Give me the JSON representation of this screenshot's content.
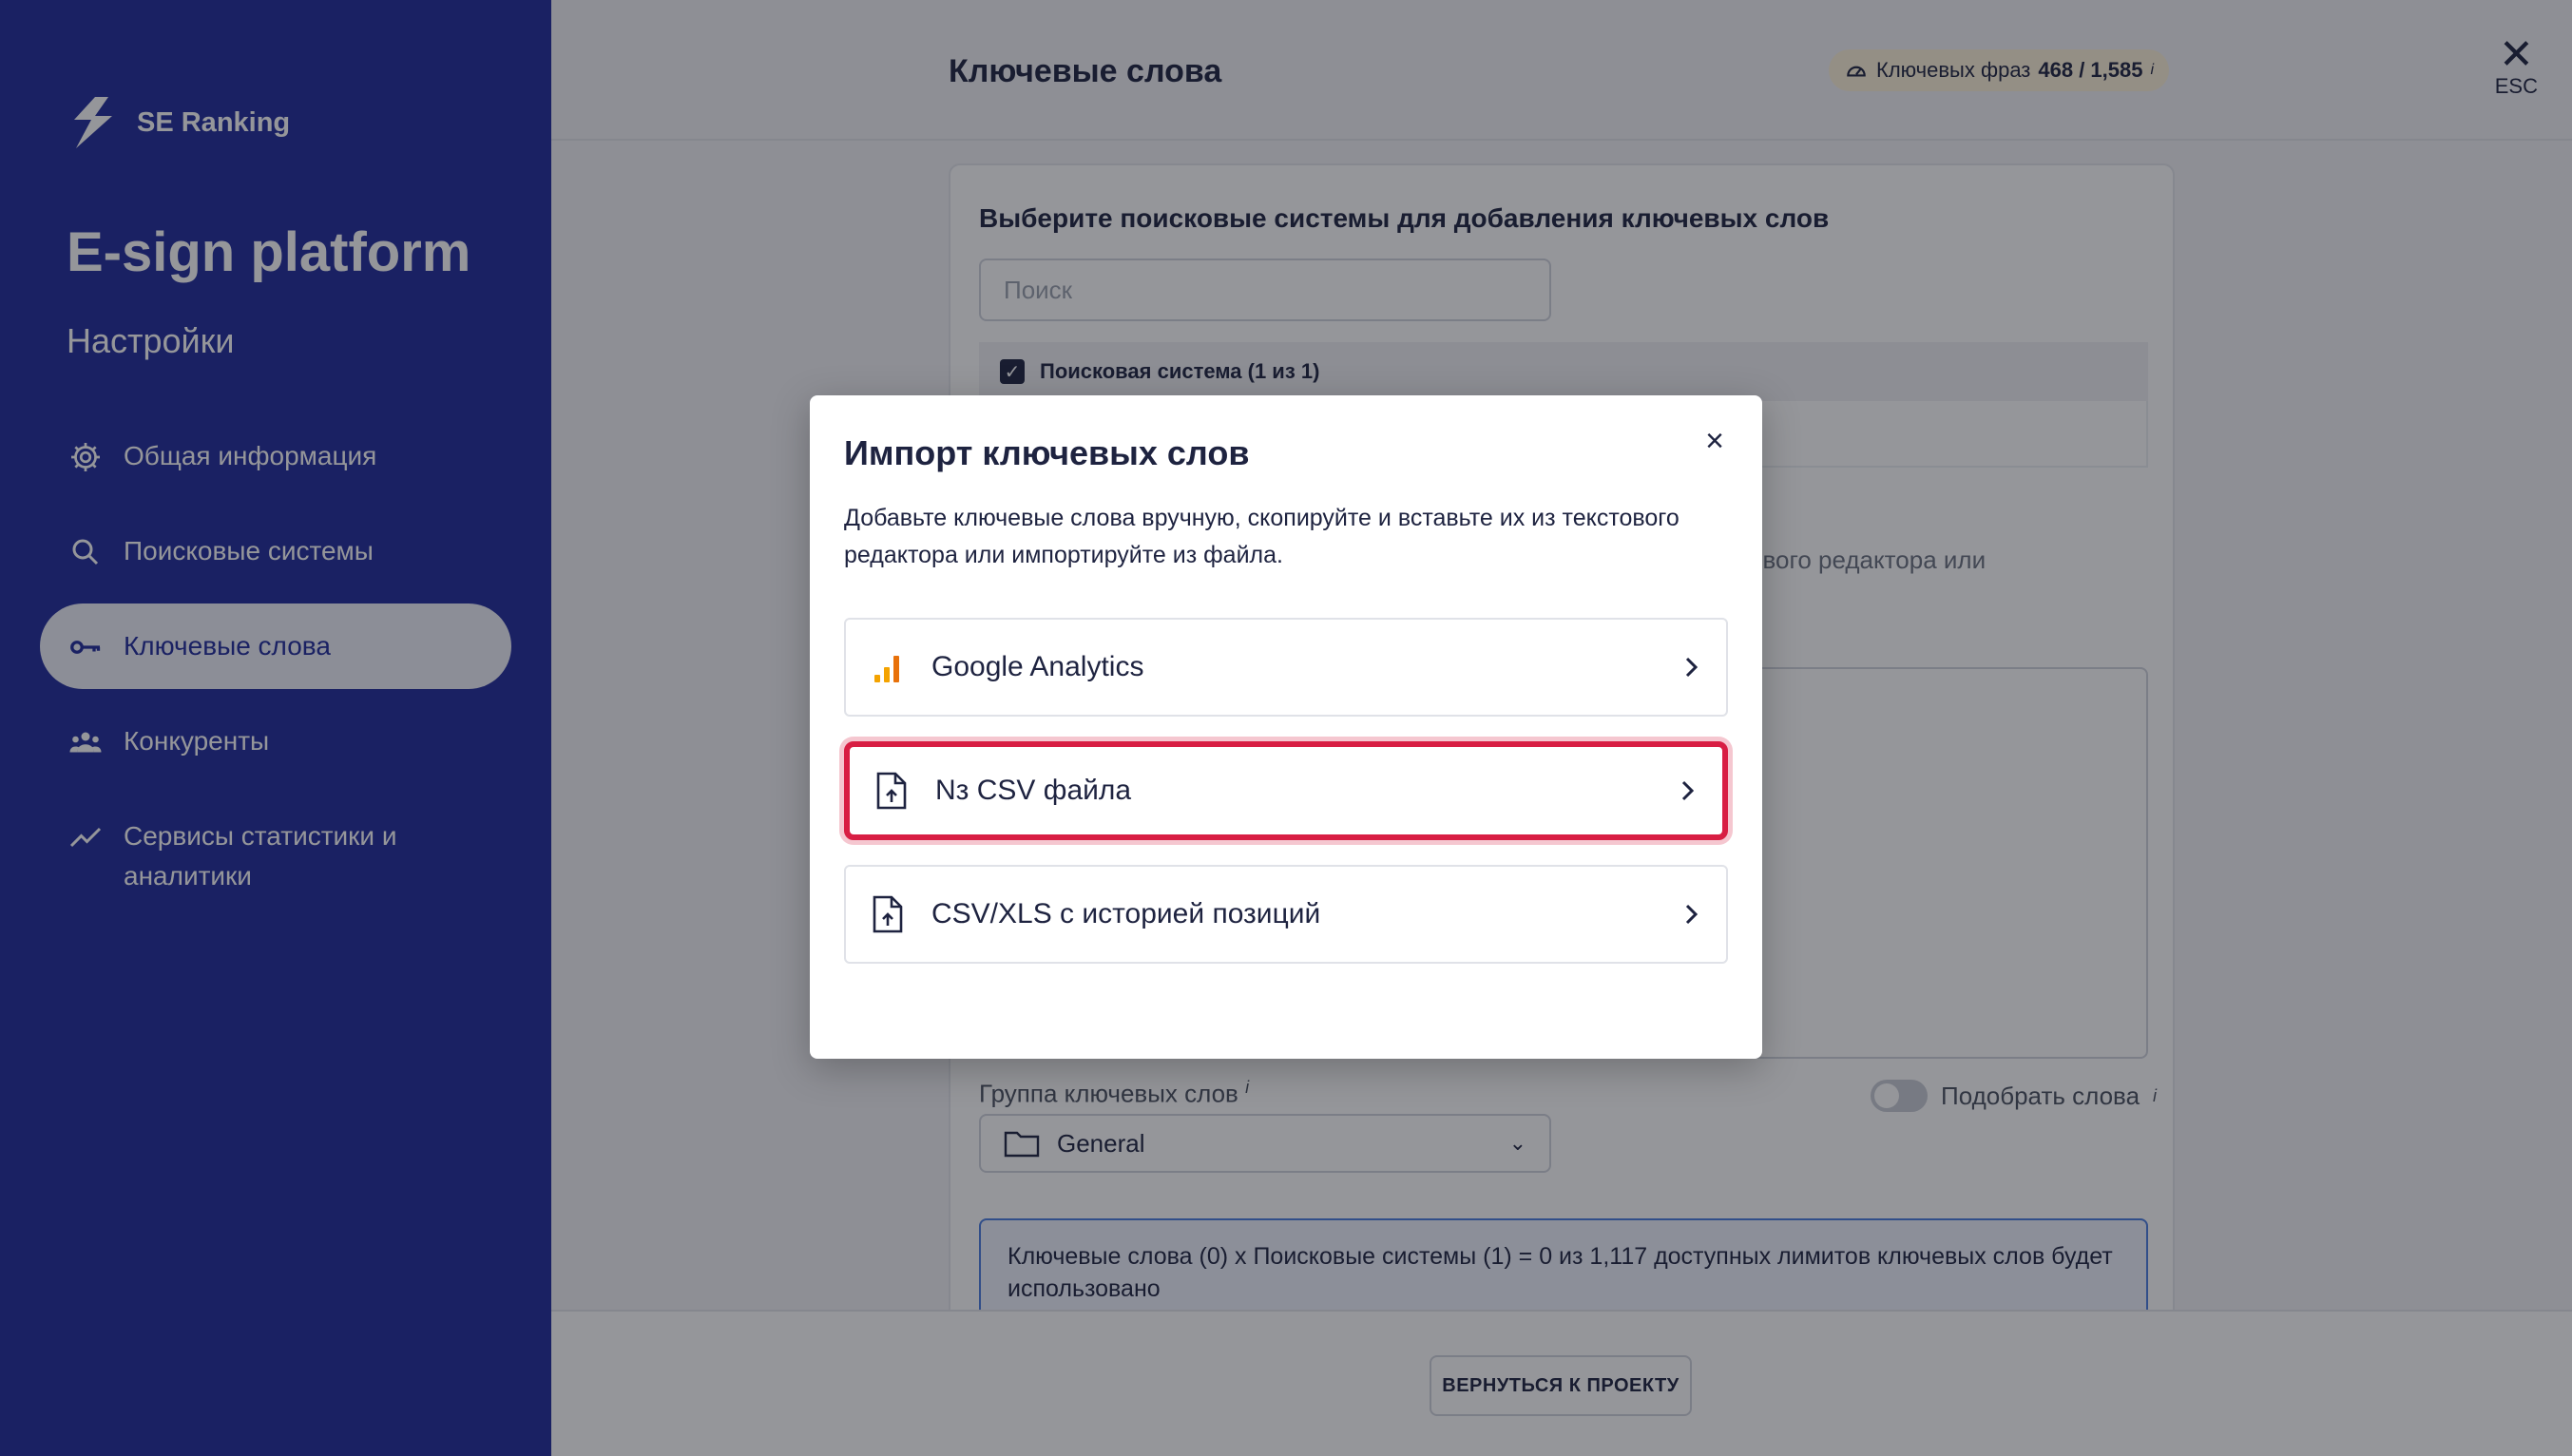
{
  "sidebar": {
    "logo_text": "SE Ranking",
    "project_name": "E-sign platform",
    "section_title": "Настройки",
    "items": [
      {
        "label": "Общая информация",
        "icon": "gear-icon"
      },
      {
        "label": "Поисковые системы",
        "icon": "search-icon"
      },
      {
        "label": "Ключевые слова",
        "icon": "key-icon",
        "active": true
      },
      {
        "label": "Конкуренты",
        "icon": "users-icon"
      },
      {
        "label": "Сервисы статистики и аналитики",
        "icon": "trend-icon"
      }
    ]
  },
  "header": {
    "title": "Ключевые слова",
    "limits_label": "Ключевых фраз",
    "limits_value": "468 / 1,585",
    "limits_info": "i",
    "esc_label": "ESC"
  },
  "card": {
    "heading": "Выберите поисковые системы для добавления ключевых слов",
    "search_placeholder": "Поиск",
    "engine_header": "Поисковая система (1 из 1)",
    "bg_partial_text": "ового редактора или",
    "group_label": "Группа ключевых слов",
    "group_info": "i",
    "group_value": "General",
    "pick_label": "Подобрать слова",
    "pick_info": "i",
    "info_text": "Ключевые слова (0) x Поисковые системы (1) = 0 из 1,117 доступных лимитов ключевых слов будет использовано"
  },
  "footer": {
    "back_button": "ВЕРНУТЬСЯ К ПРОЕКТУ"
  },
  "modal": {
    "title": "Импорт ключевых слов",
    "description": "Добавьте ключевые слова вручную, скопируйте и вставьте их из текстового редактора или импортируйте из файла.",
    "options": [
      {
        "label": "Google Analytics",
        "icon": "google-analytics-icon"
      },
      {
        "label": "Nз CSV файла",
        "icon": "file-upload-icon",
        "highlighted": true
      },
      {
        "label": "CSV/XLS с историей позиций",
        "icon": "file-upload-icon"
      }
    ]
  },
  "colors": {
    "sidebar_bg": "#1f2a9b",
    "highlight": "#d81e43",
    "ga_orange": "#f4a300"
  }
}
